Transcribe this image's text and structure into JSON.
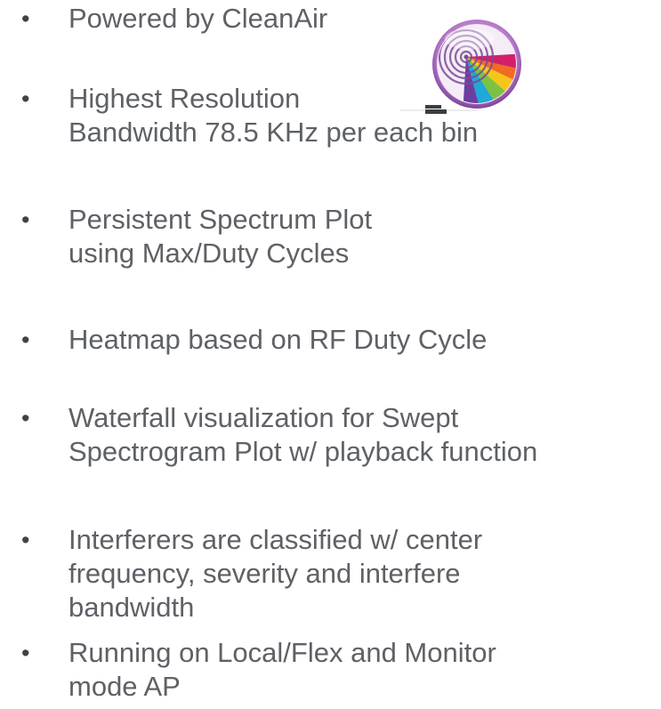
{
  "bullets": [
    {
      "lines": [
        "Powered by CleanAir"
      ]
    },
    {
      "lines": [
        "Highest Resolution",
        "Bandwidth 78.5 KHz per each bin"
      ]
    },
    {
      "lines": [
        "Persistent Spectrum Plot",
        "using Max/Duty Cycles"
      ]
    },
    {
      "lines": [
        "Heatmap based on RF Duty Cycle"
      ]
    },
    {
      "lines": [
        "Waterfall visualization for Swept",
        "Spectrogram Plot w/ playback function"
      ]
    },
    {
      "lines": [
        "Interferers are classified w/ center",
        "frequency, severity and interfere",
        "bandwidth"
      ]
    },
    {
      "lines": [
        "Running on Local/Flex and Monitor",
        "mode AP"
      ]
    }
  ],
  "bullet_symbol": "•",
  "logo": {
    "icon": "spectrum-analyzer-icon",
    "colors": [
      "#d21f6c",
      "#f26b22",
      "#f5c61a",
      "#7cc242",
      "#1fa8d8",
      "#6a3fa0"
    ]
  }
}
